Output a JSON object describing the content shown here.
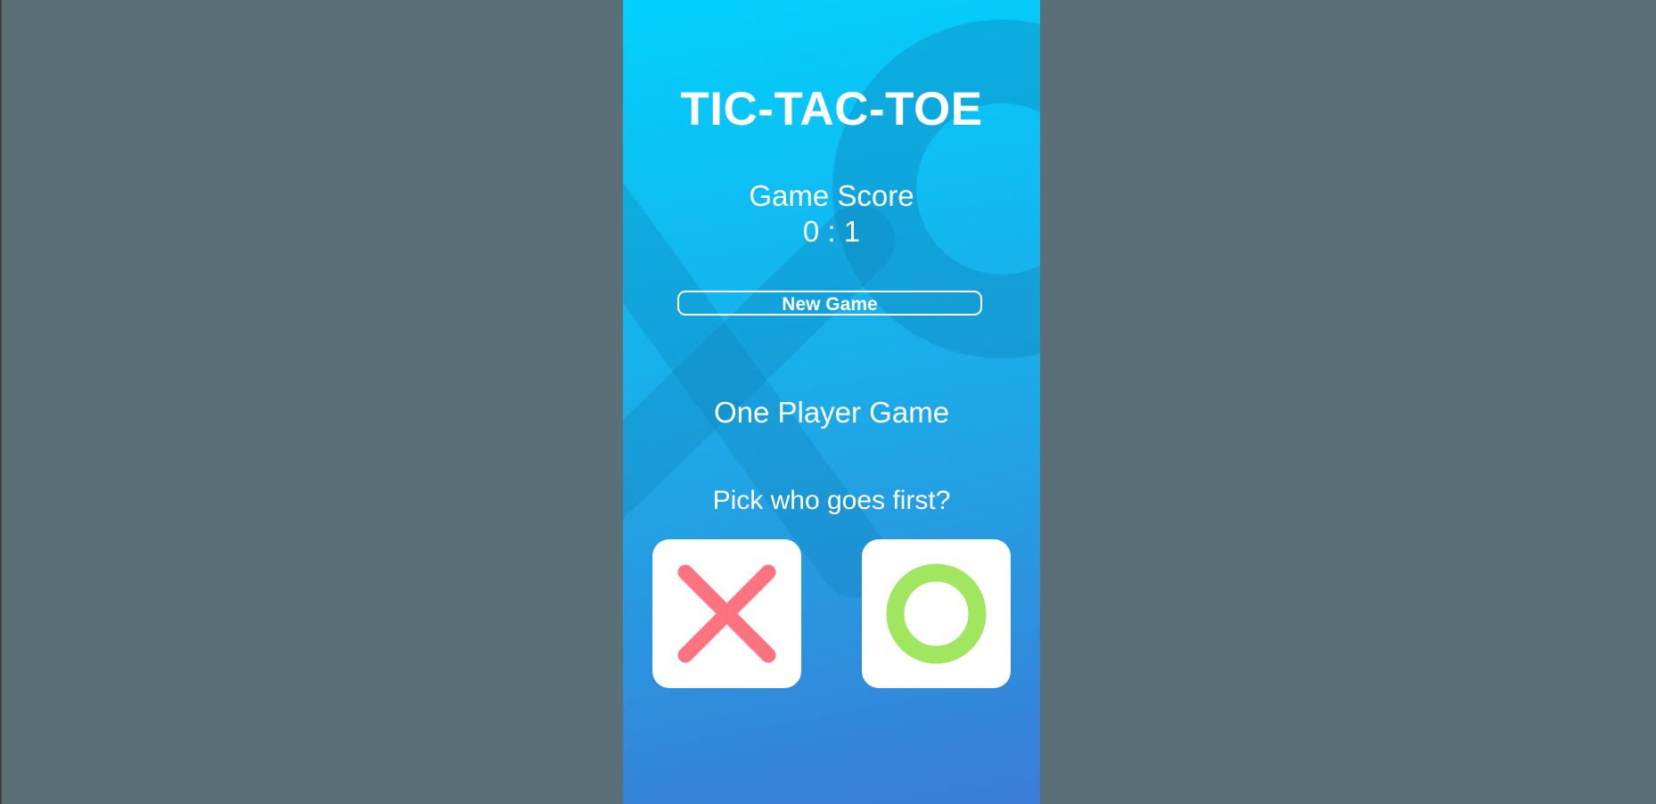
{
  "game": {
    "title": "TIC-TAC-TOE",
    "score_label": "Game Score",
    "score_value": "0 : 1",
    "new_game_label": "New Game",
    "mode_label": "One Player Game",
    "pick_label": "Pick who goes first?"
  },
  "choices": [
    {
      "symbol": "X",
      "icon": "x-icon",
      "color": "#fd737f"
    },
    {
      "symbol": "O",
      "icon": "o-icon",
      "color": "#a0e65f"
    }
  ],
  "colors": {
    "background": "#5b7076",
    "gradient_top": "#01d1fe",
    "gradient_bottom": "#3a7cd6",
    "text": "#ffffff",
    "x_mark": "#fd737f",
    "o_mark": "#a0e65f"
  }
}
